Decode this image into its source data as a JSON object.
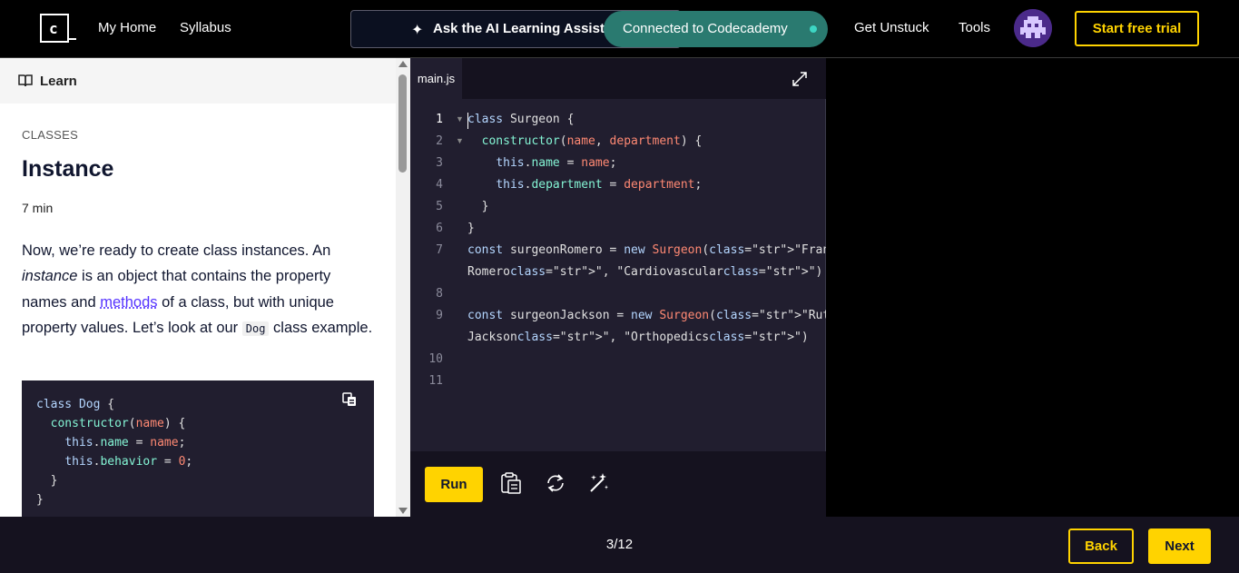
{
  "nav": {
    "logo_text": "c",
    "my_home": "My Home",
    "syllabus": "Syllabus",
    "ai_assistant": "Ask the AI Learning Assista",
    "toast": "Connected to Codecademy",
    "get_unstuck": "Get Unstuck",
    "tools": "Tools",
    "start_trial": "Start free trial"
  },
  "learn": {
    "header": "Learn",
    "kicker": "CLASSES",
    "title": "Instance",
    "duration": "7 min",
    "para_1": "Now, we’re ready to create class instances. An ",
    "para_em": "instance",
    "para_2": " is an object that contains the property names and ",
    "para_link": "methods",
    "para_3": " of a class, but with unique property values. Let’s look at our ",
    "para_code": "Dog",
    "para_4": " class example.",
    "code_lines": [
      "class Dog {",
      "  constructor(name) {",
      "    this.name = name;",
      "    this.behavior = 0;",
      "  }",
      "}"
    ]
  },
  "editor": {
    "tab": "main.js",
    "line_numbers": [
      "1",
      "2",
      "3",
      "4",
      "5",
      "6",
      "7",
      "",
      "8",
      "9",
      "",
      "10",
      "11"
    ],
    "lines": [
      "class Surgeon {",
      "  constructor(name, department) {",
      "    this.name = name;",
      "    this.department = department;",
      "  }",
      "}",
      "const surgeonRomero = new Surgeon(\"Francisco",
      "Romero\", \"Cardiovascular\")",
      "",
      "const surgeonJackson = new Surgeon(\"Ruth",
      "Jackson\", \"Orthopedics\")",
      "",
      ""
    ],
    "run_label": "Run"
  },
  "footer": {
    "progress": "3/12",
    "back": "Back",
    "next": "Next"
  },
  "colors": {
    "accent": "#ffd300",
    "toast_bg": "#2a7a70",
    "editor_bg": "#211e2f",
    "link": "#5533ff"
  }
}
